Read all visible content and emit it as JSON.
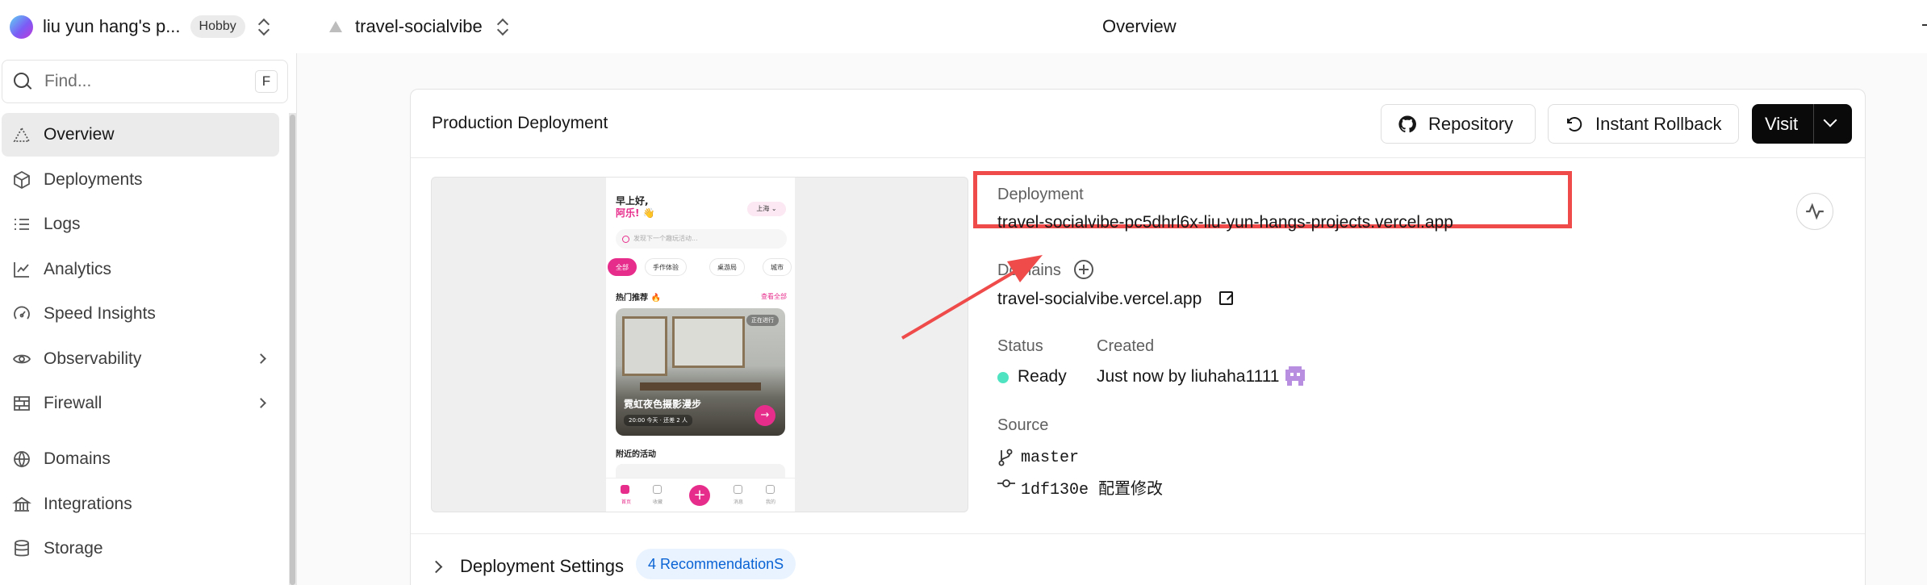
{
  "topbar": {
    "team_name": "liu yun hang's p...",
    "plan": "Hobby",
    "project_name": "travel-socialvibe",
    "page_title": "Overview"
  },
  "sidebar": {
    "find_placeholder": "Find...",
    "find_shortcut": "F",
    "items": [
      {
        "label": "Overview",
        "icon": "overview-triangle-icon",
        "active": true
      },
      {
        "label": "Deployments",
        "icon": "cube-icon"
      },
      {
        "label": "Logs",
        "icon": "logs-list-icon"
      },
      {
        "label": "Analytics",
        "icon": "line-chart-icon"
      },
      {
        "label": "Speed Insights",
        "icon": "gauge-icon"
      },
      {
        "label": "Observability",
        "icon": "eye-icon",
        "has_submenu": true
      },
      {
        "label": "Firewall",
        "icon": "brick-wall-icon",
        "has_submenu": true
      },
      {
        "label": "Domains",
        "icon": "globe-icon"
      },
      {
        "label": "Integrations",
        "icon": "integrations-icon"
      },
      {
        "label": "Storage",
        "icon": "database-icon"
      }
    ]
  },
  "deployment_card": {
    "title": "Production Deployment",
    "repository_button": "Repository",
    "rollback_button": "Instant Rollback",
    "visit_button": "Visit",
    "deployment_label": "Deployment",
    "deployment_url": "travel-socialvibe-pc5dhrl6x-liu-yun-hangs-projects.vercel.app",
    "domains_label": "Domains",
    "domain_url": "travel-socialvibe.vercel.app",
    "status_label": "Status",
    "status_value": "Ready",
    "status_color": "#50e3c2",
    "created_label": "Created",
    "created_value": "Just now by liuhaha1111",
    "source_label": "Source",
    "branch": "master",
    "commit_hash": "1df130e",
    "commit_message": "配置修改",
    "settings_label": "Deployment Settings",
    "recommendations_badge": "4 RecommendationS"
  },
  "preview": {
    "greeting_line1": "早上好,",
    "greeting_line2": "阿乐! 👋",
    "location": "上海 ⌄",
    "search_placeholder": "发现下一个趣玩活动...",
    "chips": [
      "全部",
      "手作体验",
      "桌游局",
      "城市"
    ],
    "section_hot": "热门推荐 🔥",
    "see_all": "查看全部",
    "card_badge": "正在进行",
    "card_title": "霓虹夜色摄影漫步",
    "card_meta": "20:00 今天 · 还差 2 人",
    "section_nearby": "附近的活动",
    "tabs": [
      "首页",
      "收藏",
      "",
      "消息",
      "我的"
    ]
  },
  "colors": {
    "accent_pink": "#e72d8c",
    "annotation_red": "#ef4b4b",
    "badge_blue": "#0a63d4"
  }
}
